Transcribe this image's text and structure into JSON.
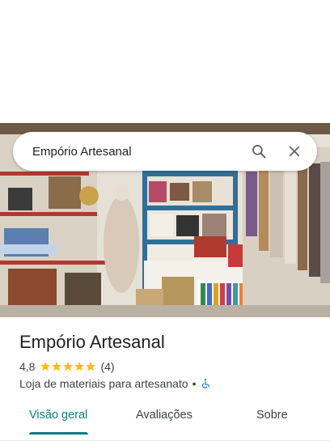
{
  "search": {
    "query": "Empório Artesanal"
  },
  "place": {
    "name": "Empório Artesanal",
    "rating": "4,8",
    "stars": 5,
    "review_count": "(4)",
    "category": "Loja de materiais para artesanato",
    "separator": "•"
  },
  "tabs": [
    {
      "label": "Visão geral",
      "active": true
    },
    {
      "label": "Avaliações",
      "active": false
    },
    {
      "label": "Sobre",
      "active": false
    }
  ],
  "colors": {
    "accent": "#0b7b7b",
    "star": "#fbbc04",
    "accessibility": "#1a73e8"
  },
  "icons": {
    "search": "search-icon",
    "close": "close-icon",
    "wheelchair": "wheelchair-icon",
    "star": "star-icon"
  }
}
